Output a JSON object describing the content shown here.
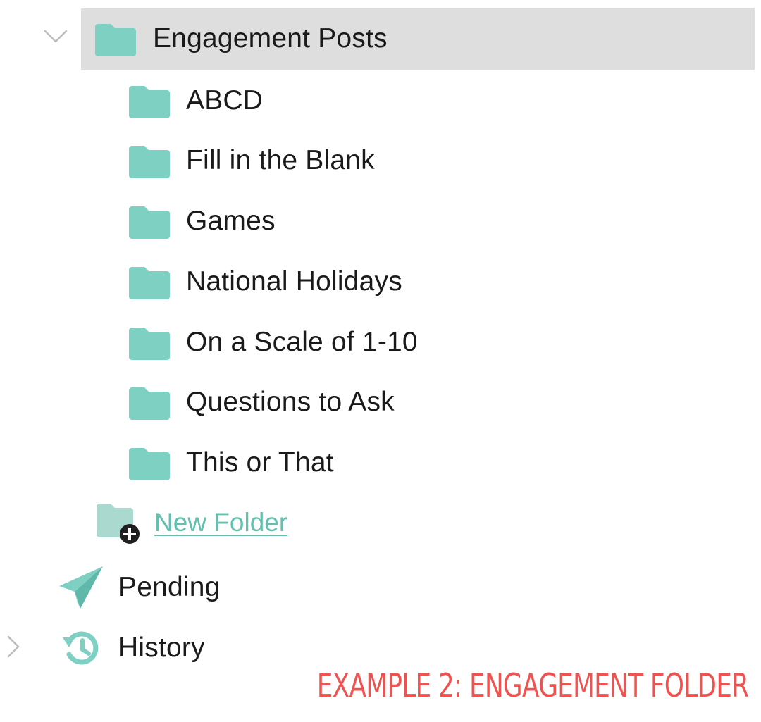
{
  "tree": {
    "root_folder": {
      "label": "Engagement Posts",
      "expanded": true,
      "selected": true,
      "icon": "folder-icon",
      "color": "#7ed0c3"
    },
    "subfolders": [
      {
        "label": "ABCD"
      },
      {
        "label": "Fill in the Blank"
      },
      {
        "label": "Games"
      },
      {
        "label": "National Holidays"
      },
      {
        "label": "On a Scale of 1-10"
      },
      {
        "label": "Questions to Ask"
      },
      {
        "label": "This or That"
      }
    ],
    "new_folder": {
      "label": "New Folder",
      "icon": "add-folder-icon",
      "color": "#63bfae"
    },
    "pending": {
      "label": "Pending",
      "icon": "paper-plane-icon"
    },
    "history": {
      "label": "History",
      "icon": "history-icon",
      "collapsed": true
    }
  },
  "caption": {
    "text": "EXAMPLE 2: ENGAGEMENT FOLDER",
    "color": "#ef5350"
  },
  "colors": {
    "folder": "#7ed0c3",
    "selection": "#dedede",
    "chevron": "#bdbdbd"
  }
}
